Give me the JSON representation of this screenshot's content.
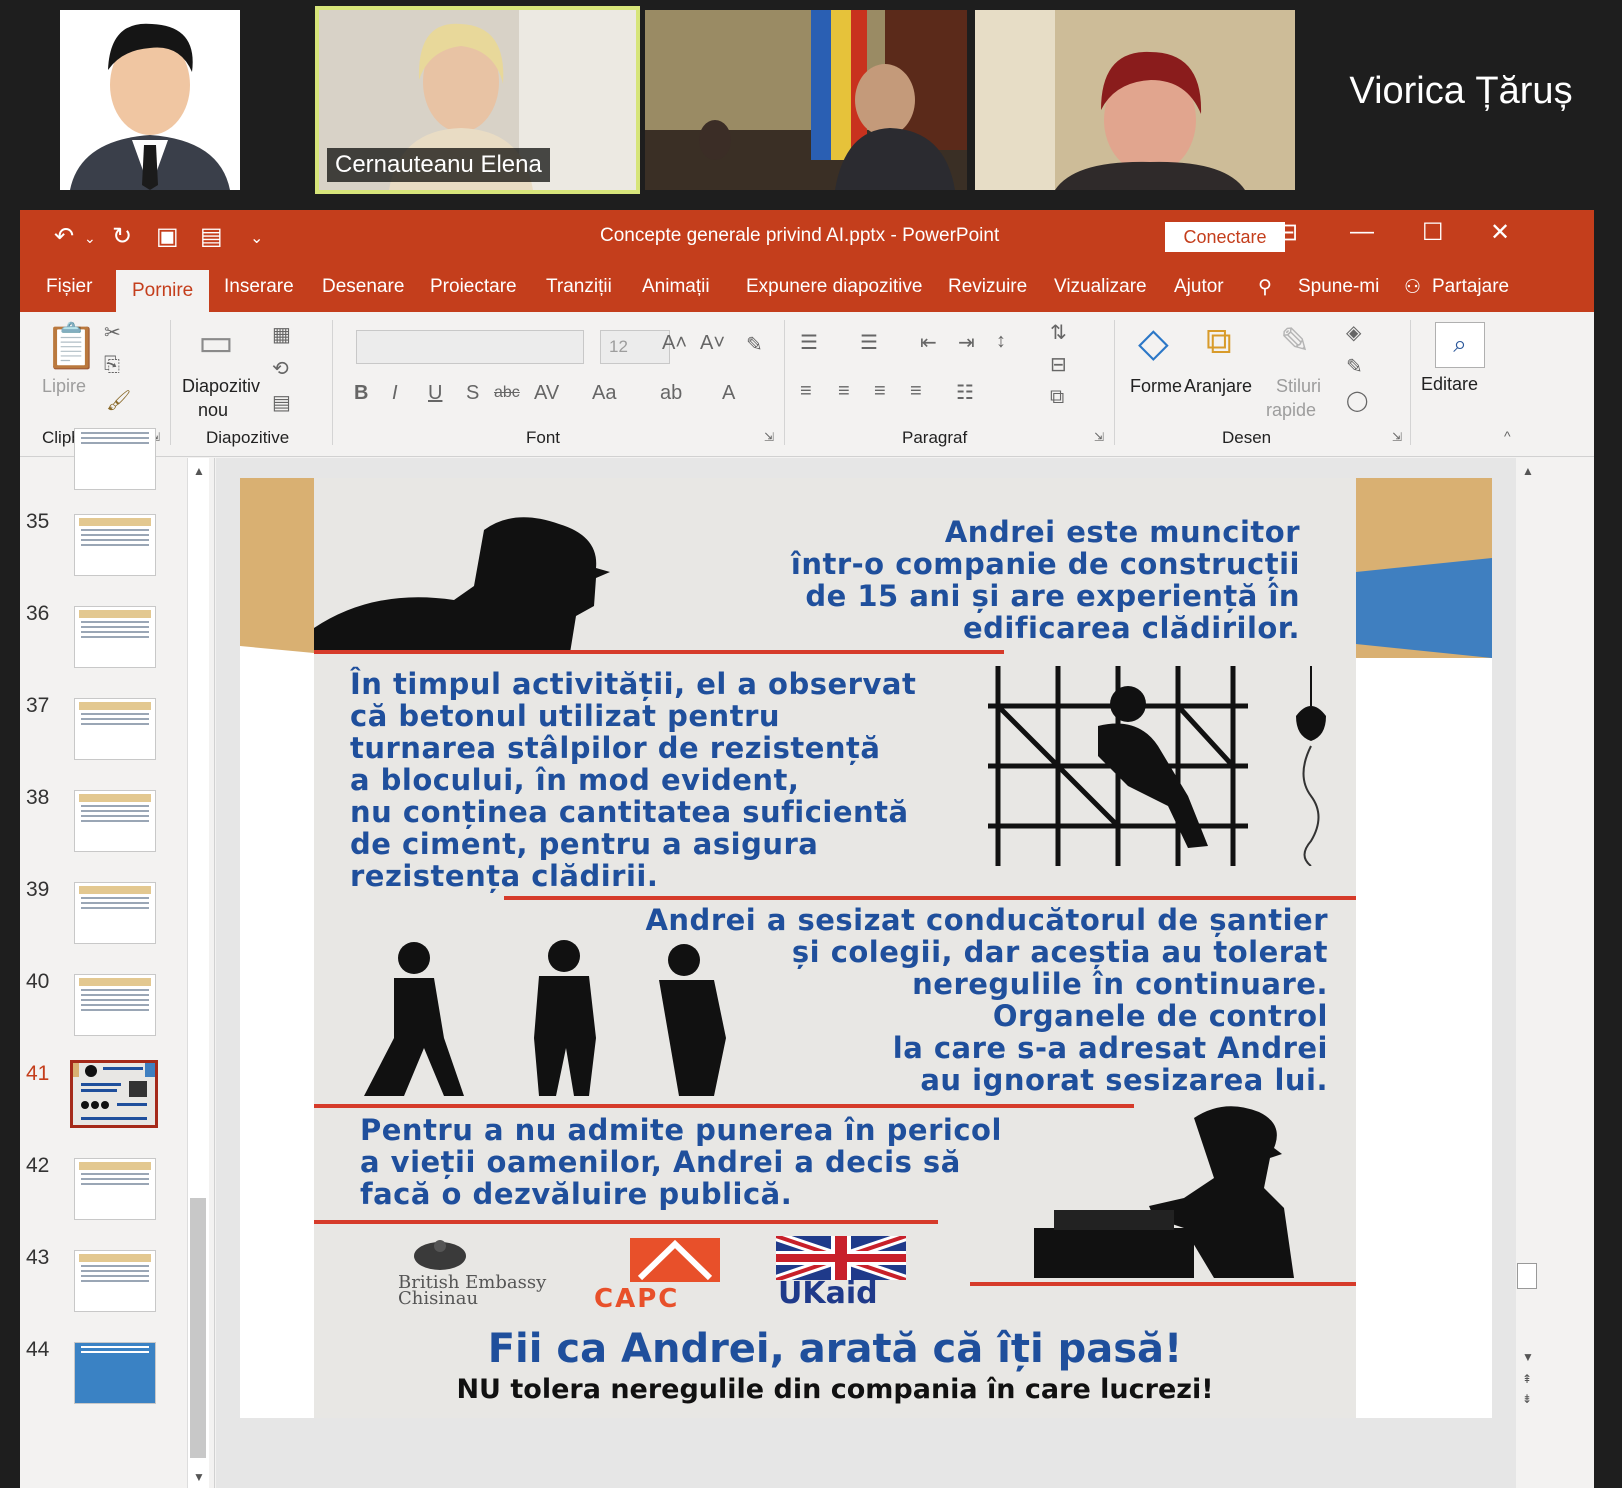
{
  "video": {
    "participants": [
      {
        "name": ""
      },
      {
        "name": "Cernauteanu Elena"
      },
      {
        "name": ""
      },
      {
        "name": ""
      }
    ],
    "speaker_label": "Viorica Țăruș"
  },
  "window": {
    "title": "Concepte generale privind AI.pptx  -  PowerPoint",
    "connect": "Conectare"
  },
  "tabs": [
    "Fișier",
    "Pornire",
    "Inserare",
    "Desenare",
    "Proiectare",
    "Tranziții",
    "Animații",
    "Expunere diapozitive",
    "Revizuire",
    "Vizualizare",
    "Ajutor",
    "Spune-mi",
    "Partajare"
  ],
  "ribbon": {
    "clipboard": {
      "label": "Clipboard",
      "paste": "Lipire"
    },
    "slides": {
      "label": "Diapozitive",
      "new_slide_1": "Diapozitiv",
      "new_slide_2": "nou"
    },
    "font": {
      "label": "Font",
      "size": "12"
    },
    "paragraph": {
      "label": "Paragraf"
    },
    "drawing": {
      "label": "Desen",
      "shapes": "Forme",
      "arrange": "Aranjare",
      "quick_styles_1": "Stiluri",
      "quick_styles_2": "rapide"
    },
    "editing": {
      "label": "Editare"
    }
  },
  "thumbnails": {
    "numbers": [
      "35",
      "36",
      "37",
      "38",
      "39",
      "40",
      "41",
      "42",
      "43",
      "44"
    ],
    "active": "41"
  },
  "slide": {
    "block1": "Andrei este muncitor\nîntr-o companie de construcții\nde 15 ani și are experiență în\nedificarea clădirilor.",
    "block2": "În timpul activității, el a observat\ncă betonul utilizat pentru\nturnarea stâlpilor de rezistență\na blocului, în mod evident,\nnu conținea cantitatea suficientă\nde ciment, pentru a asigura\nrezistența clădirii.",
    "block3": "Andrei a sesizat conducătorul de șantier\nși colegii, dar aceștia au tolerat\nneregulile în continuare.\nOrganele de control\nla care s-a adresat Andrei\nau ignorat sesizarea lui.",
    "block4": "Pentru a nu admite punerea în pericol\na vieții oamenilor, Andrei a decis să\nfacă o dezvăluire publică.",
    "logos": {
      "embassy_1": "British Embassy",
      "embassy_2": "Chisinau",
      "capc": "CAPC",
      "ukaid": "UKaid"
    },
    "tagline": "Fii ca Andrei, arată că îți pasă!",
    "subtagline": "NU tolera neregulile din compania în care lucrezi!"
  },
  "colors": {
    "ppt_accent": "#c43e1c",
    "slide_text_blue": "#1f4f9c",
    "slide_red_line": "#d63b2a"
  }
}
